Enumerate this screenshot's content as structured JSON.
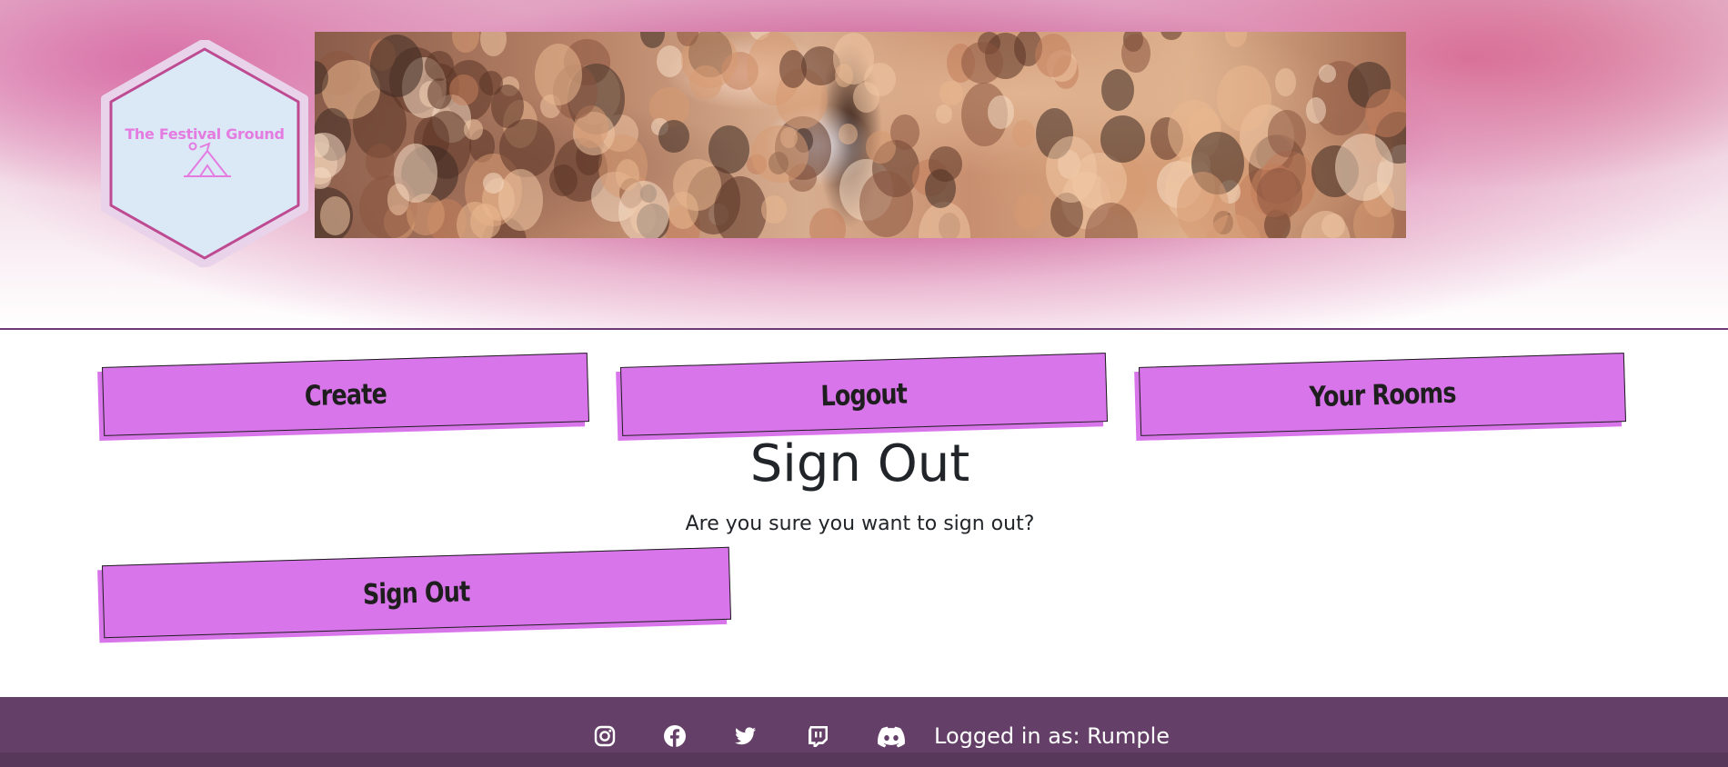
{
  "header": {
    "logo_title": "The Festival Ground",
    "banner_image": "festival-crowd"
  },
  "nav": {
    "buttons": [
      {
        "label": "Create"
      },
      {
        "label": "Logout"
      },
      {
        "label": "Your Rooms"
      }
    ]
  },
  "main": {
    "title": "Sign Out",
    "subtitle": "Are you sure you want to sign out?",
    "signout_label": "Sign Out"
  },
  "footer": {
    "social_icons": [
      "instagram-icon",
      "facebook-icon",
      "twitter-icon",
      "twitch-icon",
      "discord-icon"
    ],
    "logged_in_text": "Logged in as: Rumple"
  },
  "colors": {
    "button": "#d975ea",
    "footer": "#643f68",
    "header_pink": "#c9568f",
    "logo_bg": "#dbe9f7",
    "logo_accent": "#e47be0",
    "text": "#212529"
  }
}
